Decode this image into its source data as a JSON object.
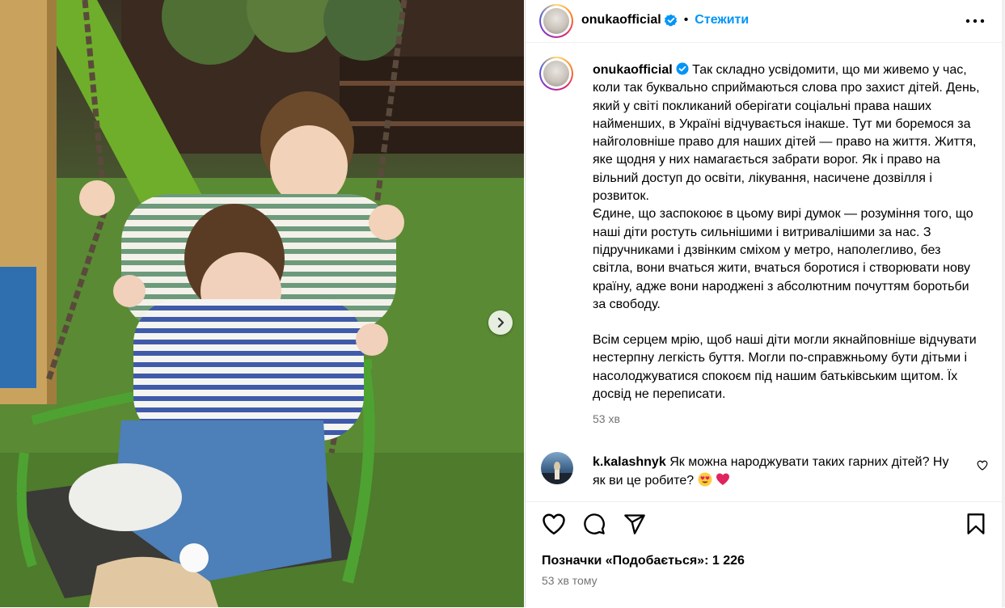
{
  "post": {
    "username": "onukaofficial",
    "follow_label": "Стежити",
    "caption_paragraphs": [
      "Так складно усвідомити, що ми живемо у час, коли так буквально сприймаються слова про захист дітей. День, який у світі покликаний оберігати соціальні права наших найменших, в Україні відчувається інакше. Тут ми боремося за найголовніше право для наших дітей — право на життя. Життя, яке щодня у них намагається забрати ворог. Як і право на вільний доступ до освіти, лікування, насичене дозвілля і розвиток.",
      "Єдине, що заспокоює в цьому вирі думок — розуміння того, що наші діти ростуть сильнішими і витривалішими за нас. З підручниками і дзвінким сміхом у метро, наполегливо, без світла, вони вчаться жити, вчаться боротися і створювати нову країну, адже вони народжені з абсолютним почуттям боротьби за свободу.",
      "Всім серцем мрію, щоб наші діти могли якнайповніше відчувати нестерпну легкість буття. Могли по-справжньому бути дітьми і насолоджуватися спокоєм під нашим батьківським щитом. Їх досвід не переписати."
    ],
    "caption_time": "53 хв",
    "likes_label": "Позначки «Подобається»: 1 226",
    "posted_time": "53 хв тому"
  },
  "comment": {
    "username": "k.kalashnyk",
    "text": "Як можна народжувати таких гарних дітей? Ну як ви це робите?"
  },
  "icons": [
    "verified-badge-icon",
    "more-options-icon",
    "next-arrow-icon",
    "heart-icon",
    "comment-icon",
    "share-icon",
    "bookmark-icon",
    "heart-small-icon",
    "heart-eyes-emoji",
    "red-heart-emoji"
  ],
  "colors": {
    "accent": "#0095f6",
    "muted": "#737373",
    "border": "#dbdbdb"
  }
}
